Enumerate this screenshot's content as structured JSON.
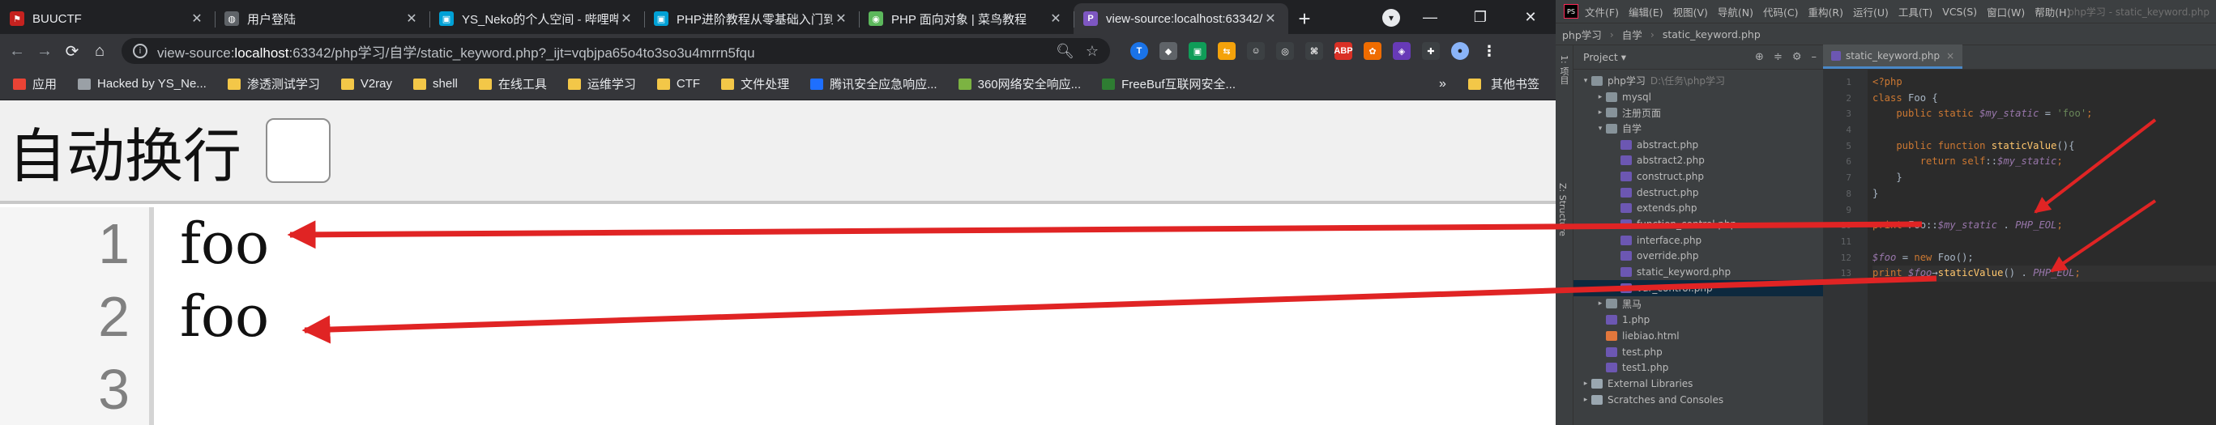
{
  "browser": {
    "tabs": [
      {
        "title": "BUUCTF",
        "icon": "flag-icon",
        "active": false
      },
      {
        "title": "用户登陆",
        "icon": "globe-icon",
        "active": false
      },
      {
        "title": "YS_Neko的个人空间 - 哔哩哔哩",
        "icon": "bilibili-icon",
        "active": false
      },
      {
        "title": "PHP进阶教程从零基础入门到…",
        "icon": "bilibili-icon",
        "active": false
      },
      {
        "title": "PHP 面向对象 | 菜鸟教程",
        "icon": "runoob-icon",
        "active": false
      },
      {
        "title": "view-source:localhost:63342/",
        "icon": "phpstorm-icon",
        "active": true
      }
    ],
    "new_tab": "+",
    "window_controls": {
      "minimize": "—",
      "restore": "❐",
      "close": "✕"
    },
    "nav": {
      "back": "←",
      "forward": "→",
      "reload": "⟳",
      "home": "⌂"
    },
    "address": {
      "prefix": "view-source:",
      "host": "localhost",
      "rest": ":63342/php学习/自学/static_keyword.php?_ijt=vqbjpa65o4to3so3u4mrrn5fqu"
    },
    "bookmarks": [
      {
        "label": "应用",
        "icon": "apps-icon"
      },
      {
        "label": "Hacked by YS_Ne...",
        "icon": "globe-icon"
      },
      {
        "label": "渗透测试学习",
        "icon": "folder-icon"
      },
      {
        "label": "V2ray",
        "icon": "folder-icon"
      },
      {
        "label": "shell",
        "icon": "folder-icon"
      },
      {
        "label": "在线工具",
        "icon": "folder-icon"
      },
      {
        "label": "运维学习",
        "icon": "folder-icon"
      },
      {
        "label": "CTF",
        "icon": "folder-icon"
      },
      {
        "label": "文件处理",
        "icon": "folder-icon"
      },
      {
        "label": "腾讯安全应急响应...",
        "icon": "tencent-icon"
      },
      {
        "label": "360网络安全响应...",
        "icon": "360-icon"
      },
      {
        "label": "FreeBuf互联网安全...",
        "icon": "freebuf-icon"
      }
    ],
    "bookmarks_more": "»",
    "bookmarks_other": "其他书签",
    "wrap": {
      "label": "自动换行"
    },
    "source": {
      "lines": [
        {
          "num": "1",
          "text": "foo"
        },
        {
          "num": "2",
          "text": "foo"
        },
        {
          "num": "3",
          "text": ""
        }
      ]
    }
  },
  "ide": {
    "menu": [
      "文件(F)",
      "编辑(E)",
      "视图(V)",
      "导航(N)",
      "代码(C)",
      "重构(R)",
      "运行(U)",
      "工具(T)",
      "VCS(S)",
      "窗口(W)",
      "帮助(H)"
    ],
    "window_title": "php学习 - static_keyword.php",
    "breadcrumb": [
      "php学习",
      "自学",
      "static_keyword.php"
    ],
    "side_labels": [
      "1: 项目",
      "Z: Structure"
    ],
    "project_header": "Project",
    "tree": [
      {
        "indent": 0,
        "arrow": "▾",
        "type": "dir",
        "label": "php学习",
        "extra": "D:\\任务\\php学习"
      },
      {
        "indent": 1,
        "arrow": "▸",
        "type": "dir",
        "label": "mysql"
      },
      {
        "indent": 1,
        "arrow": "▸",
        "type": "dir",
        "label": "注册页面"
      },
      {
        "indent": 1,
        "arrow": "▾",
        "type": "dir",
        "label": "自学"
      },
      {
        "indent": 2,
        "arrow": "",
        "type": "php",
        "label": "abstract.php"
      },
      {
        "indent": 2,
        "arrow": "",
        "type": "php",
        "label": "abstract2.php"
      },
      {
        "indent": 2,
        "arrow": "",
        "type": "php",
        "label": "construct.php"
      },
      {
        "indent": 2,
        "arrow": "",
        "type": "php",
        "label": "destruct.php"
      },
      {
        "indent": 2,
        "arrow": "",
        "type": "php",
        "label": "extends.php"
      },
      {
        "indent": 2,
        "arrow": "",
        "type": "php",
        "label": "function_control.php"
      },
      {
        "indent": 2,
        "arrow": "",
        "type": "php",
        "label": "interface.php"
      },
      {
        "indent": 2,
        "arrow": "",
        "type": "php",
        "label": "override.php"
      },
      {
        "indent": 2,
        "arrow": "",
        "type": "php",
        "label": "static_keyword.php"
      },
      {
        "indent": 2,
        "arrow": "",
        "type": "php",
        "label": "var_control.php",
        "selected": true
      },
      {
        "indent": 1,
        "arrow": "▸",
        "type": "dir",
        "label": "黑马"
      },
      {
        "indent": 1,
        "arrow": "",
        "type": "php",
        "label": "1.php"
      },
      {
        "indent": 1,
        "arrow": "",
        "type": "html",
        "label": "liebiao.html"
      },
      {
        "indent": 1,
        "arrow": "",
        "type": "php",
        "label": "test.php"
      },
      {
        "indent": 1,
        "arrow": "",
        "type": "php",
        "label": "test1.php"
      },
      {
        "indent": 0,
        "arrow": "▸",
        "type": "lib",
        "label": "External Libraries"
      },
      {
        "indent": 0,
        "arrow": "▸",
        "type": "lib",
        "label": "Scratches and Consoles"
      }
    ],
    "editor_tab": "static_keyword.php",
    "gutter": [
      "1",
      "2",
      "3",
      "4",
      "5",
      "6",
      "7",
      "8",
      "9",
      "10",
      "11",
      "12",
      "13"
    ],
    "code": [
      [
        {
          "t": "<?php",
          "c": "tag"
        }
      ],
      [
        {
          "t": "class ",
          "c": "k"
        },
        {
          "t": "Foo",
          "c": ""
        },
        {
          "t": " {",
          "c": ""
        }
      ],
      [
        {
          "t": "    public static ",
          "c": "k"
        },
        {
          "t": "$my_static",
          "c": "v"
        },
        {
          "t": " = ",
          "c": ""
        },
        {
          "t": "'foo'",
          "c": "s"
        },
        {
          "t": ";",
          "c": "k"
        }
      ],
      [
        {
          "t": "",
          "c": ""
        }
      ],
      [
        {
          "t": "    public function ",
          "c": "k"
        },
        {
          "t": "staticValue",
          "c": "f"
        },
        {
          "t": "(){",
          "c": ""
        }
      ],
      [
        {
          "t": "        return self",
          "c": "k"
        },
        {
          "t": "::",
          "c": ""
        },
        {
          "t": "$my_static",
          "c": "v"
        },
        {
          "t": ";",
          "c": "k"
        }
      ],
      [
        {
          "t": "    }",
          "c": ""
        }
      ],
      [
        {
          "t": "}",
          "c": ""
        }
      ],
      [
        {
          "t": "",
          "c": ""
        }
      ],
      [
        {
          "t": "print ",
          "c": "k"
        },
        {
          "t": "Foo",
          "c": ""
        },
        {
          "t": "::",
          "c": ""
        },
        {
          "t": "$my_static",
          "c": "v"
        },
        {
          "t": " . ",
          "c": ""
        },
        {
          "t": "PHP_EOL",
          "c": "c"
        },
        {
          "t": ";",
          "c": "k"
        }
      ],
      [
        {
          "t": "",
          "c": ""
        }
      ],
      [
        {
          "t": "$foo",
          "c": "v"
        },
        {
          "t": " = ",
          "c": ""
        },
        {
          "t": "new ",
          "c": "k"
        },
        {
          "t": "Foo",
          "c": ""
        },
        {
          "t": "();",
          "c": ""
        }
      ],
      [
        {
          "t": "print ",
          "c": "k"
        },
        {
          "t": "$foo",
          "c": "v"
        },
        {
          "t": "→",
          "c": ""
        },
        {
          "t": "staticValue",
          "c": "f"
        },
        {
          "t": "() . ",
          "c": ""
        },
        {
          "t": "PHP_EOL",
          "c": "c"
        },
        {
          "t": ";",
          "c": "k"
        }
      ]
    ],
    "current_line": 13
  },
  "colors": {
    "annotation_arrow": "#e02424",
    "chrome_dark": "#202124",
    "ide_bg": "#2b2b2b"
  }
}
